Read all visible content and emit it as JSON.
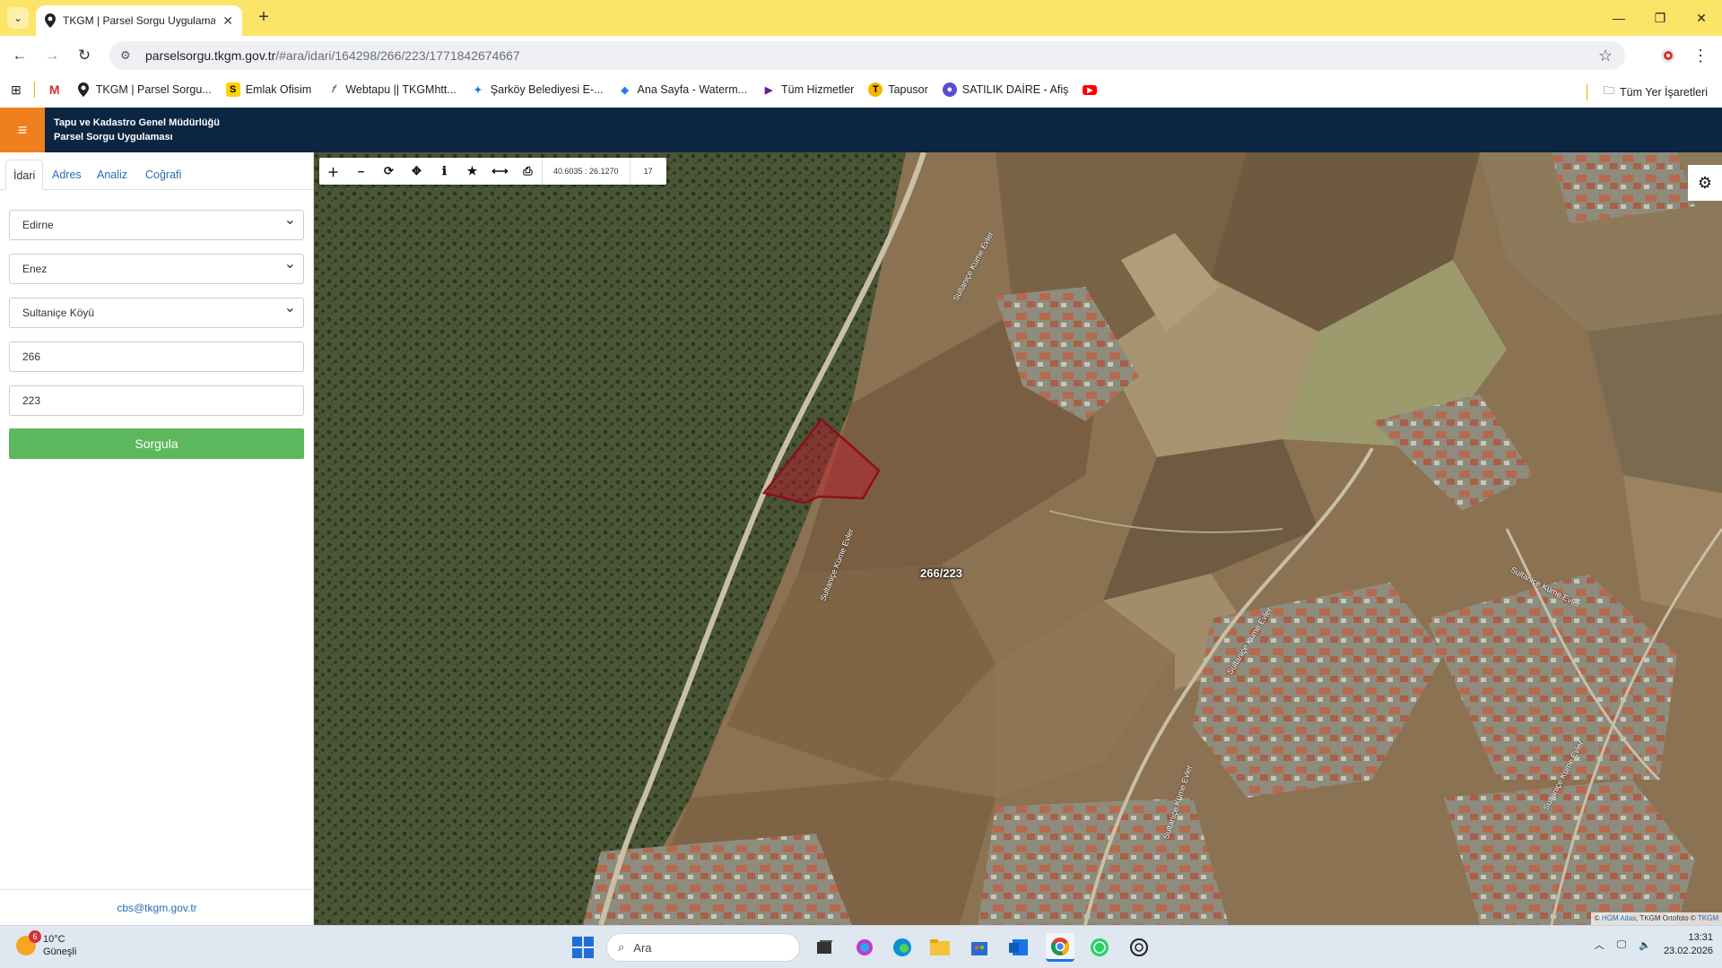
{
  "browser": {
    "tab_title": "TKGM | Parsel Sorgu Uygulaması",
    "url_host": "parselsorgu.tkgm.gov.tr",
    "url_path": "/#ara/idari/164298/266/223/1771842674667",
    "bookmarks": [
      {
        "label": "",
        "icon": "gmail-icon",
        "color": "#d93025"
      },
      {
        "label": "TKGM | Parsel Sorgu...",
        "icon": "location-pin-icon",
        "color": "#222222"
      },
      {
        "label": "Emlak Ofisim",
        "icon": "s-logo-icon",
        "color": "#ffd400"
      },
      {
        "label": "Webtapu || TKGMhtt...",
        "icon": "webtapu-icon",
        "color": "#555555"
      },
      {
        "label": "Şarköy Belediyesi E-...",
        "icon": "sarkoy-icon",
        "color": "#1a73e8"
      },
      {
        "label": "Ana Sayfa - Waterm...",
        "icon": "watermark-icon",
        "color": "#1a73e8"
      },
      {
        "label": "Tüm Hizmetler",
        "icon": "play-arrow-icon",
        "color": "#6a1b9a"
      },
      {
        "label": "Tapusor",
        "icon": "tapusor-icon",
        "color": "#f5b400"
      },
      {
        "label": "SATILIK DAİRE - Afiş",
        "icon": "afis-icon",
        "color": "#5c4dcf"
      },
      {
        "label": "",
        "icon": "youtube-icon",
        "color": "#ff0000"
      }
    ],
    "all_bookmarks_label": "Tüm Yer İşaretleri"
  },
  "app": {
    "title_line1": "Tapu ve Kadastro Genel Müdürlüğü",
    "title_line2": "Parsel Sorgu Uygulaması"
  },
  "panel": {
    "tabs": [
      "İdari",
      "Adres",
      "Analiz",
      "Coğrafi"
    ],
    "active_tab": "İdari",
    "province": "Edirne",
    "district": "Enez",
    "neighborhood": "Sultaniçe Köyü",
    "block": "266",
    "parcel": "223",
    "query_button": "Sorgula",
    "footer_email": "cbs@tkgm.gov.tr"
  },
  "map": {
    "coordinates": "40.6035 : 26.1270",
    "zoom": "17",
    "parcel_label": "266/223",
    "road_labels": [
      "Sultaniçe Küme Evler",
      "Sultaniçe Küme Evler",
      "Sultaniçe Küme Evler",
      "Sultaniçe Küme Evler",
      "Sultaniçe Küme Evler",
      "Sultaniçe Küme Evler"
    ],
    "attribution_prefix": "©",
    "attribution_link1": "HGM Atlas",
    "attribution_mid": ", TKGM Ortofoto ©",
    "attribution_link2": "TKGM",
    "parcel_color": "#c0172b"
  },
  "taskbar": {
    "weather_temp": "10°C",
    "weather_desc": "Güneşli",
    "weather_badge": "6",
    "search_placeholder": "Ara",
    "time": "13:31",
    "date": "23.02.2026"
  }
}
